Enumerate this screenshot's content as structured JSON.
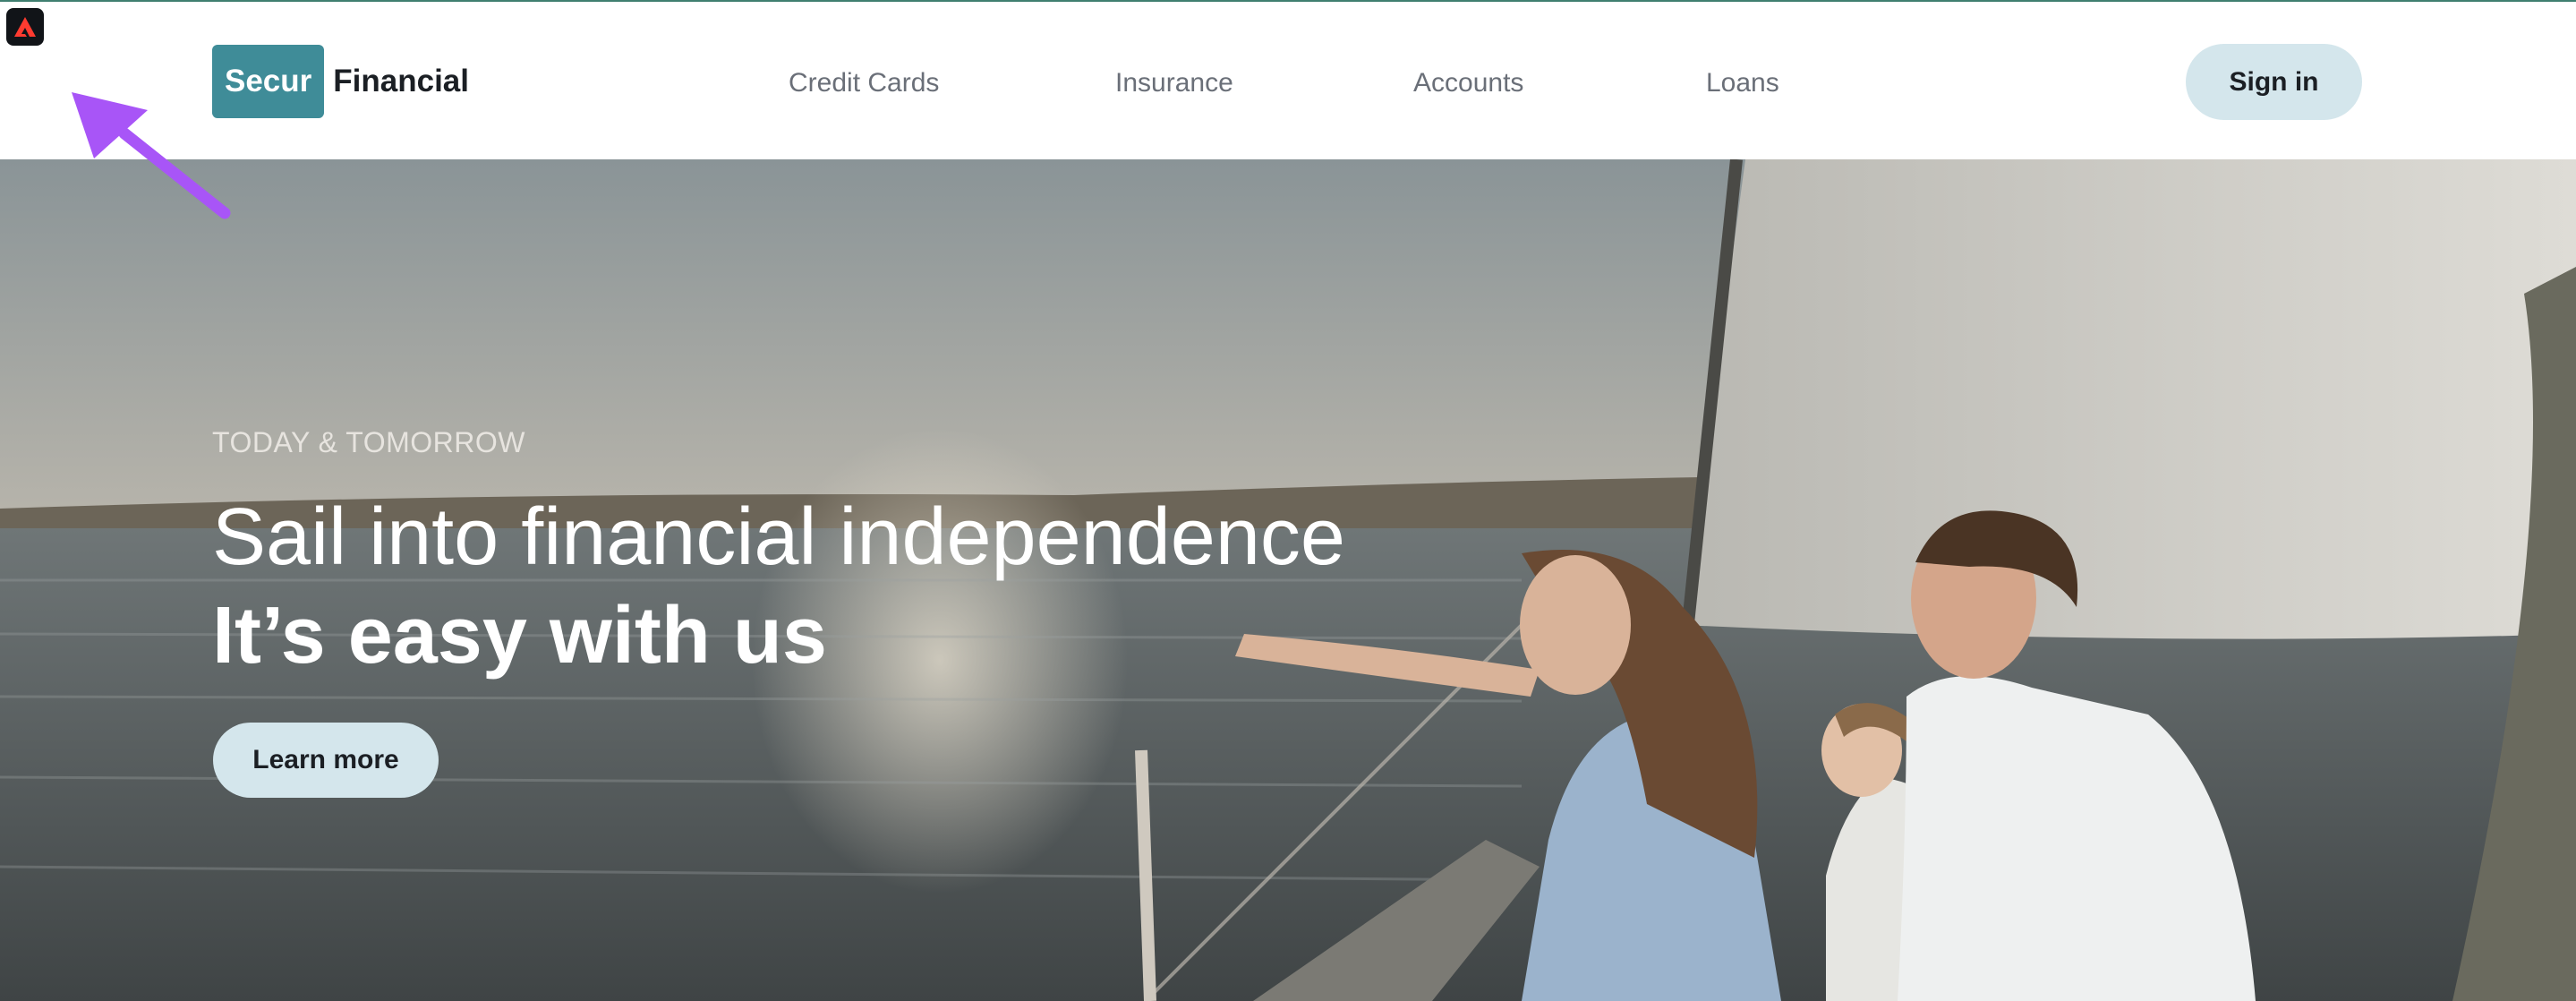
{
  "logo": {
    "mark": "Secur",
    "rest": "Financial",
    "brand_color": "#3f8c98"
  },
  "nav": {
    "items": [
      {
        "label": "Credit Cards"
      },
      {
        "label": "Insurance"
      },
      {
        "label": "Accounts"
      },
      {
        "label": "Loans"
      }
    ]
  },
  "header": {
    "sign_in_label": "Sign in"
  },
  "hero": {
    "eyebrow": "TODAY & TOMORROW",
    "headline": "Sail into financial independence",
    "subline": "It’s easy with us",
    "cta_label": "Learn more",
    "image": "family-on-sailboat-photo"
  },
  "overlay": {
    "app_icon": "adobe-icon",
    "pointer": "arrow-pointer-icon",
    "pointer_color": "#a855f7"
  },
  "colors": {
    "button_bg": "#d4e6ec",
    "text_dark": "#1b1f24",
    "nav_text": "#6a6f78"
  }
}
